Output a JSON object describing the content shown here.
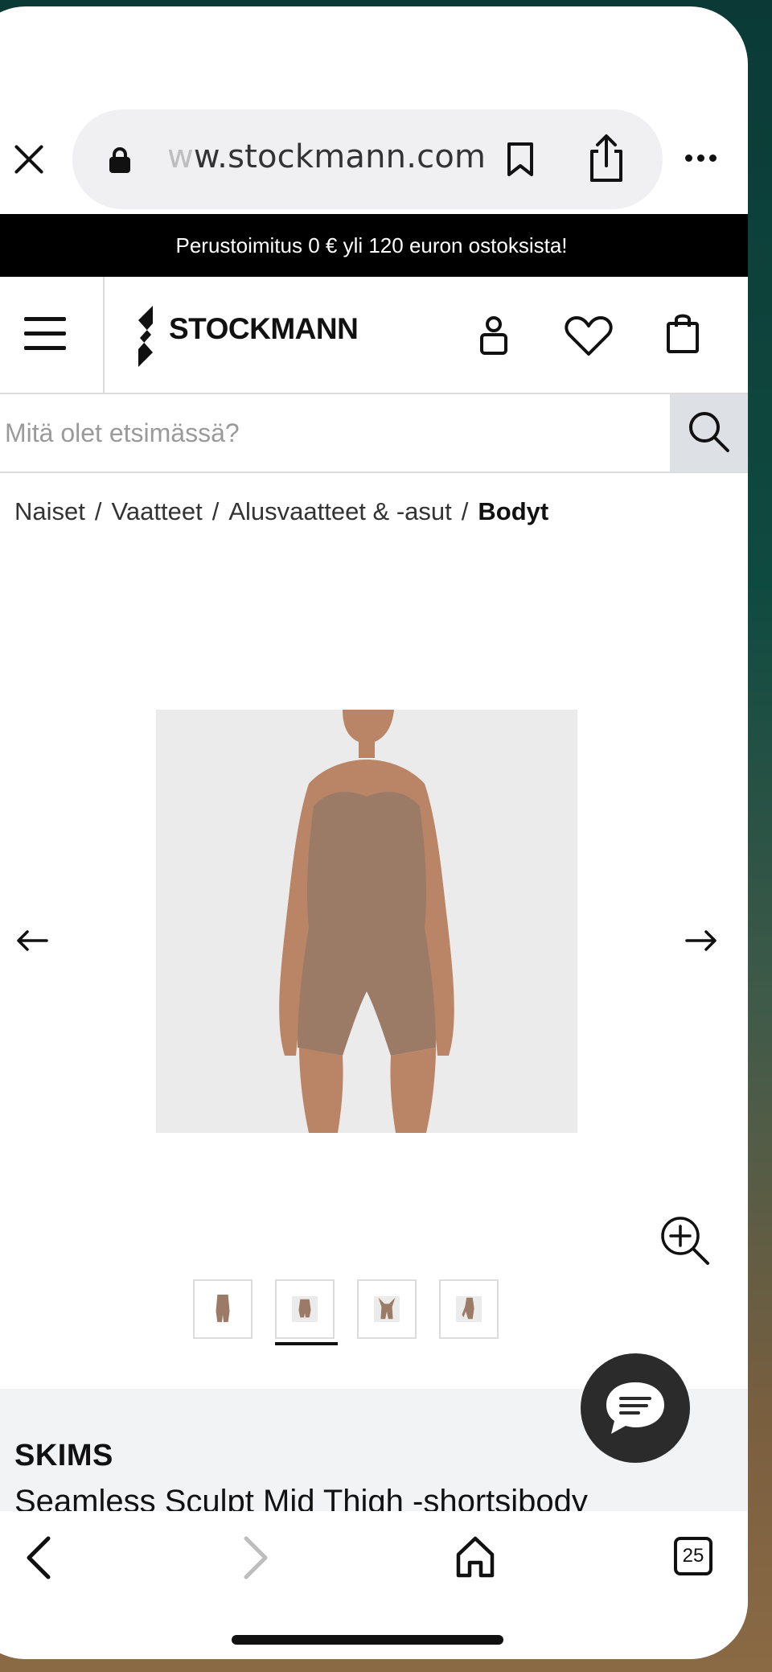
{
  "browser": {
    "url_fade": "w",
    "url_main": "w.stockmann.com",
    "tab_count": "25"
  },
  "promo": {
    "text": "Perustoimitus 0 € yli 120 euron ostoksista!"
  },
  "header": {
    "logo_text": "STOCKMANN"
  },
  "search": {
    "placeholder": "Mitä olet etsimässä?"
  },
  "breadcrumb": {
    "items": [
      "Naiset",
      "Vaatteet",
      "Alusvaatteet & -asut"
    ],
    "separator": "/",
    "current": "Bodyt"
  },
  "product": {
    "brand": "SKIMS",
    "name": "Seamless Sculpt Mid Thigh -shortsibody",
    "image_color": "#9b7a66",
    "active_thumbnail": 2
  },
  "colors": {
    "promo_bg": "#000000",
    "search_button_bg": "#dde1e5",
    "chat_bg": "#2b2b2b"
  }
}
